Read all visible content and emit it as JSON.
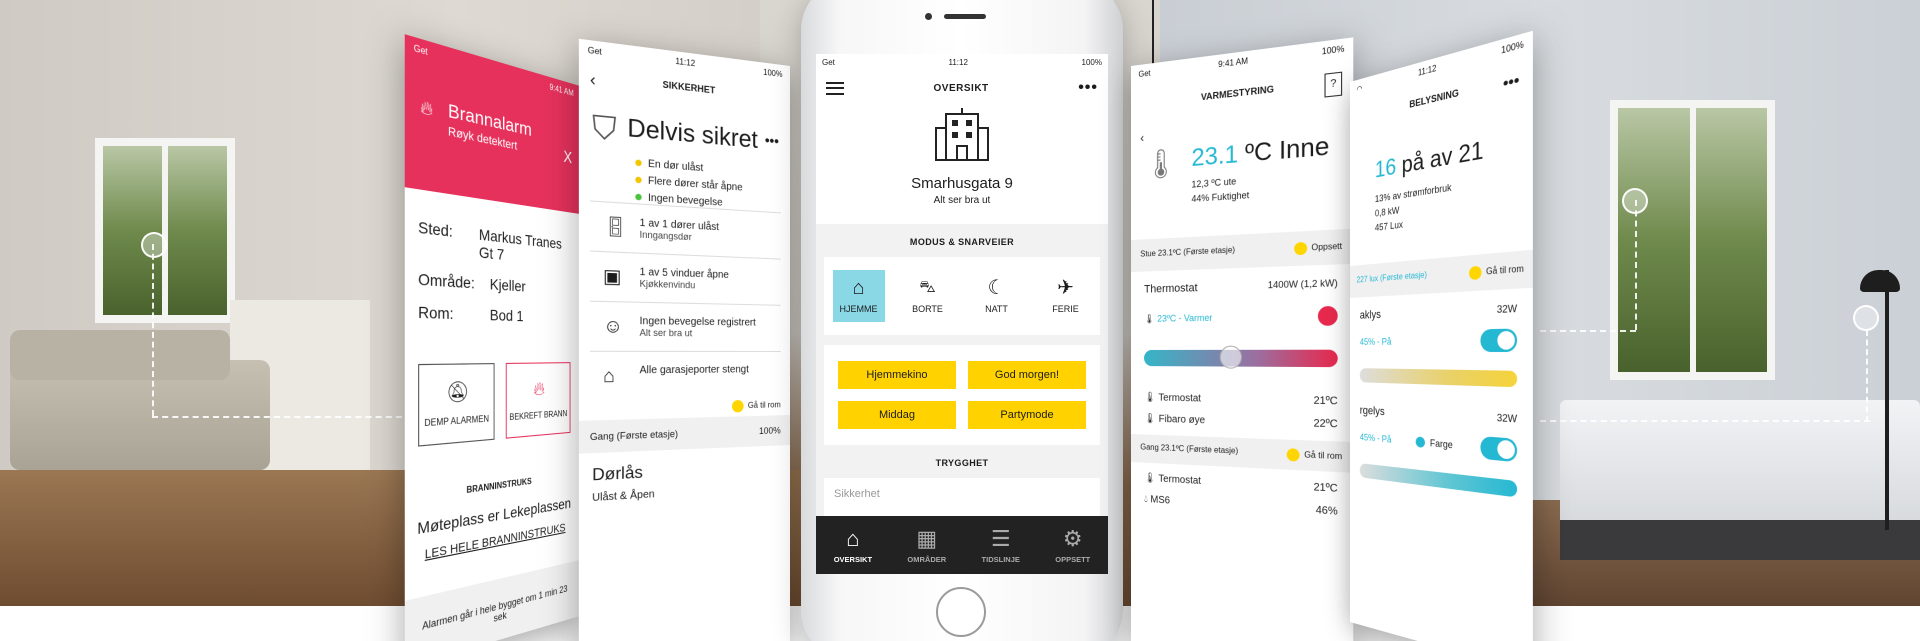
{
  "fire_alarm": {
    "status_carrier": "Get",
    "status_time": "9:41 AM",
    "title": "Brannalarm",
    "subtitle": "Røyk detektert",
    "close": "X",
    "sted_label": "Sted:",
    "sted_value": "Markus Tranes Gt 7",
    "omrade_label": "Område:",
    "omrade_value": "Kjeller",
    "rom_label": "Rom:",
    "rom_value": "Bod 1",
    "mute_button": "DEMP ALARMEN",
    "confirm_button": "BEKREFT BRANN",
    "instr_header": "BRANNINSTRUKS",
    "meeting_point": "Møteplass er Lekeplassen",
    "read_link": "LES HELE BRANNINSTRUKS",
    "footer": "Alarmen går i hele bygget om 1 min 23 sek"
  },
  "security": {
    "status_carrier": "Get",
    "status_time": "11:12",
    "status_battery": "100%",
    "title": "SIKKERHET",
    "more": "•••",
    "status": "Delvis sikret",
    "bullets": [
      "En dør ulåst",
      "Flere dører står åpne",
      "Ingen bevegelse"
    ],
    "rows": [
      {
        "t1": "1 av 1 dører ulåst",
        "t2": "Inngangsdør"
      },
      {
        "t1": "1 av 5 vinduer åpne",
        "t2": "Kjøkkenvindu"
      },
      {
        "t1": "Ingen bevegelse registrert",
        "t2": "Alt ser bra ut"
      },
      {
        "t1": "Alle garasjeporter stengt",
        "t2": ""
      }
    ],
    "goto": "Gå til rom",
    "gang": "Gang (Første etasje)",
    "gang_battery": "100%",
    "door_section": "Dørlås",
    "door_state": "Ulåst & Åpen"
  },
  "main": {
    "status_carrier": "Get",
    "status_time": "11:12",
    "status_battery": "100%",
    "title": "OVERSIKT",
    "more": "•••",
    "address": "Smarhusgata 9",
    "address_status": "Alt ser bra ut",
    "modes_header": "MODUS & SNARVEIER",
    "modes": [
      {
        "label": "HJEMME",
        "icon": "house-icon",
        "glyph": "⌂"
      },
      {
        "label": "BORTE",
        "icon": "car-icon",
        "glyph": "🚗"
      },
      {
        "label": "NATT",
        "icon": "moon-icon",
        "glyph": "☾"
      },
      {
        "label": "FERIE",
        "icon": "plane-icon",
        "glyph": "✈"
      }
    ],
    "shortcuts": [
      "Hjemmekino",
      "God morgen!",
      "Middag",
      "Partymode"
    ],
    "safety_header": "TRYGGHET",
    "safety_preview": "Sikkerhet",
    "tabs": [
      {
        "label": "OVERSIKT",
        "icon": "home-tab-icon",
        "glyph": "⌂"
      },
      {
        "label": "OMRÅDER",
        "icon": "grid-icon",
        "glyph": "▦"
      },
      {
        "label": "TIDSLINJE",
        "icon": "timeline-icon",
        "glyph": "☰"
      },
      {
        "label": "OPPSETT",
        "icon": "gear-icon",
        "glyph": "⚙"
      }
    ]
  },
  "heating": {
    "status_carrier": "Get",
    "status_time": "9:41 AM",
    "status_battery": "100%",
    "title": "VARMESTYRING",
    "help": "?",
    "temp_value": "23.1",
    "temp_unit": "ºC Inne",
    "outdoor": "12,3 ºC ute",
    "humidity": "44% Fuktighet",
    "stue_label": "Stue 23.1ºC (Første etasje)",
    "setup": "Oppsett",
    "thermostat": "Thermostat",
    "thermostat_power": "1400W (1,2 kW)",
    "heating_state": "23ºC - Varmer",
    "termostat1": "Termostat",
    "termostat1_val": "21ºC",
    "fibaro": "Fibaro øye",
    "fibaro_val": "22ºC",
    "gang_label": "Gang 23.1ºC (Første etasje)",
    "goto": "Gå til rom",
    "termostat2": "Termostat",
    "termostat2_val": "21ºC",
    "ms6": "MS6",
    "ms6_val": "46%"
  },
  "lighting": {
    "status_time": "11:12",
    "status_battery": "100%",
    "title": "BELYSNING",
    "more": "•••",
    "on_count": "16",
    "of_total": "på av 21",
    "consumption": "13% av strømforbruk",
    "power": "0,8 kW",
    "lux": "457 Lux",
    "room_bar": "227 lux (Første etasje)",
    "goto": "Gå til rom",
    "item1": "aklys",
    "item1_w": "32W",
    "item1_state": "45% - På",
    "item2": "rgelys",
    "item2_w": "32W",
    "item2_state": "45% - På",
    "color_label": "Farge"
  }
}
